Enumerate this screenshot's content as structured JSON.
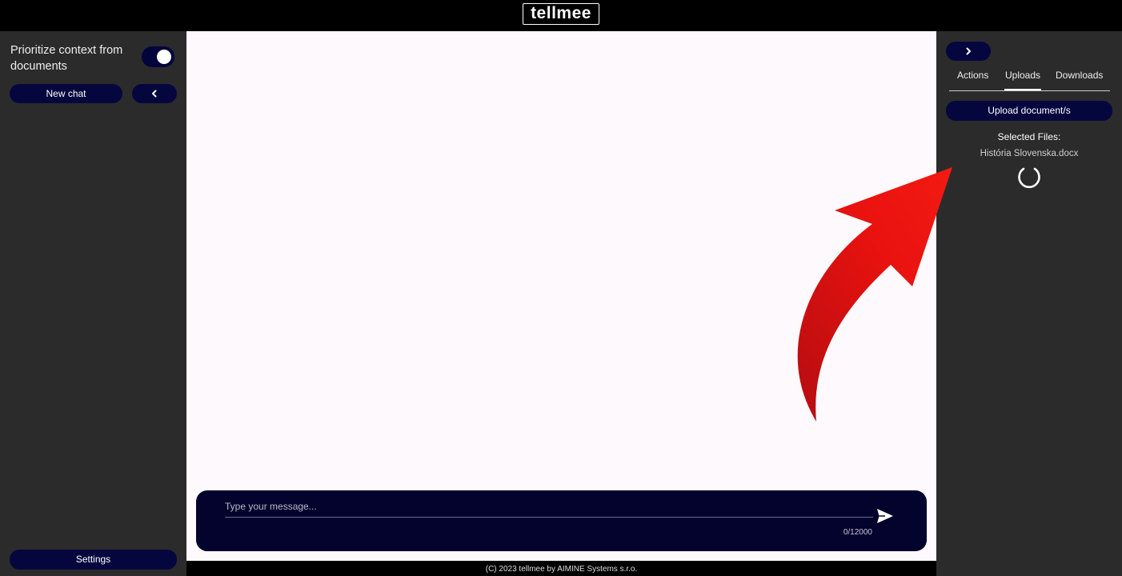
{
  "header": {
    "logo_text": "tellmee"
  },
  "sidebar_left": {
    "prioritize_label": "Prioritize context from documents",
    "prioritize_enabled": true,
    "new_chat_label": "New chat",
    "settings_label": "Settings"
  },
  "composer": {
    "placeholder": "Type your message...",
    "value": "",
    "counter": "0/12000"
  },
  "footer": {
    "text": "(C) 2023 tellmee by AIMINE Systems s.r.o."
  },
  "sidebar_right": {
    "tabs": [
      {
        "label": "Actions",
        "active": false
      },
      {
        "label": "Uploads",
        "active": true
      },
      {
        "label": "Downloads",
        "active": false
      }
    ],
    "upload_button_label": "Upload document/s",
    "selected_files_label": "Selected Files:",
    "selected_files": [
      "História Slovenska.docx"
    ],
    "uploading": true
  },
  "colors": {
    "topbar": "#000000",
    "sidebar": "#2b2b2b",
    "chat_background": "#fdf9fd",
    "button": "#06063f",
    "composer": "#03032e",
    "annotation_arrow": "#e8120f"
  },
  "icons": {
    "collapse_left": "chevron-left-icon",
    "collapse_right": "chevron-right-icon",
    "send": "send-icon",
    "loading": "spinner-icon",
    "annotation": "curved-arrow-icon"
  }
}
